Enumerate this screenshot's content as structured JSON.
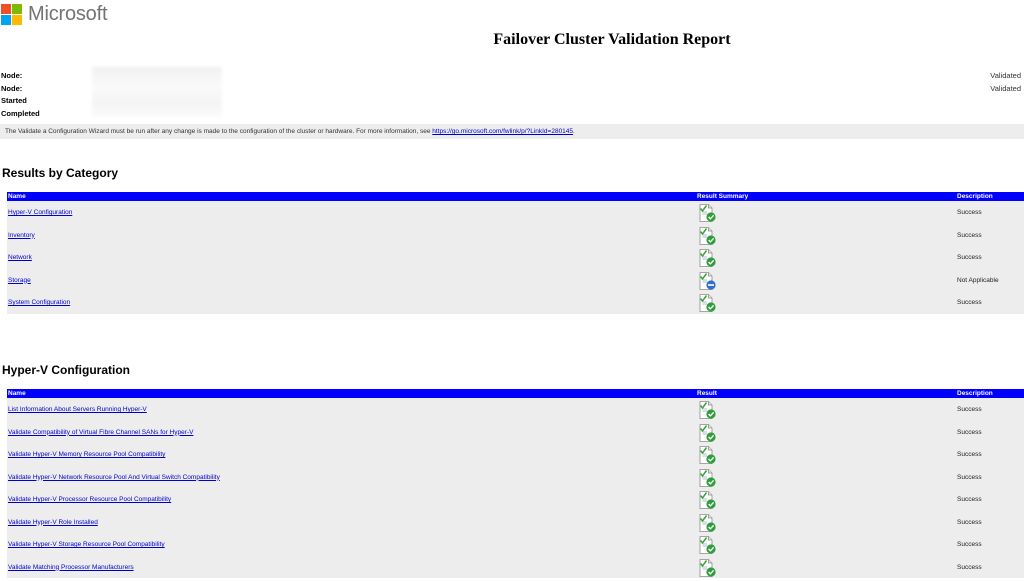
{
  "logo": {
    "text": "Microsoft",
    "colors": [
      "#f25022",
      "#7fba00",
      "#00a4ef",
      "#ffb900"
    ]
  },
  "report": {
    "title": "Failover Cluster Validation Report"
  },
  "meta": {
    "labels": [
      "Node:",
      "Node:",
      "Started",
      "Completed"
    ],
    "statuses": [
      "Validated",
      "Validated"
    ]
  },
  "notice": {
    "text": "The Validate a Configuration Wizard must be run after any change is made to the configuration of the cluster or hardware. For more information, see ",
    "link": "https://go.microsoft.com/fwlink/p/?LinkId=280145",
    "suffix": "."
  },
  "results_by_category": {
    "heading": "Results by Category",
    "columns": [
      "Name",
      "Result Summary",
      "Description"
    ],
    "rows": [
      {
        "name": "Hyper-V Configuration",
        "icon": "success-report-icon",
        "description": "Success"
      },
      {
        "name": "Inventory",
        "icon": "success-report-icon",
        "description": "Success"
      },
      {
        "name": "Network",
        "icon": "success-report-icon",
        "description": "Success"
      },
      {
        "name": "Storage",
        "icon": "not-applicable-report-icon",
        "description": "Not Applicable"
      },
      {
        "name": "System Configuration",
        "icon": "success-report-icon",
        "description": "Success"
      }
    ]
  },
  "hyperv_configuration": {
    "heading": "Hyper-V Configuration",
    "columns": [
      "Name",
      "Result",
      "Description"
    ],
    "rows": [
      {
        "name": "List Information About Servers Running Hyper-V",
        "icon": "success-report-icon",
        "description": "Success"
      },
      {
        "name": "Validate Compatibility of Virtual Fibre Channel SANs for Hyper-V",
        "icon": "success-report-icon",
        "description": "Success"
      },
      {
        "name": "Validate Hyper-V Memory Resource Pool Compatibility",
        "icon": "success-report-icon",
        "description": "Success"
      },
      {
        "name": "Validate Hyper-V Network Resource Pool And Virtual Switch Compatibility",
        "icon": "success-report-icon",
        "description": "Success"
      },
      {
        "name": "Validate Hyper-V Processor Resource Pool Compatibility",
        "icon": "success-report-icon",
        "description": "Success"
      },
      {
        "name": "Validate Hyper-V Role Installed",
        "icon": "success-report-icon",
        "description": "Success"
      },
      {
        "name": "Validate Hyper-V Storage Resource Pool Compatibility",
        "icon": "success-report-icon",
        "description": "Success"
      },
      {
        "name": "Validate Matching Processor Manufacturers",
        "icon": "success-report-icon",
        "description": "Success"
      }
    ]
  }
}
